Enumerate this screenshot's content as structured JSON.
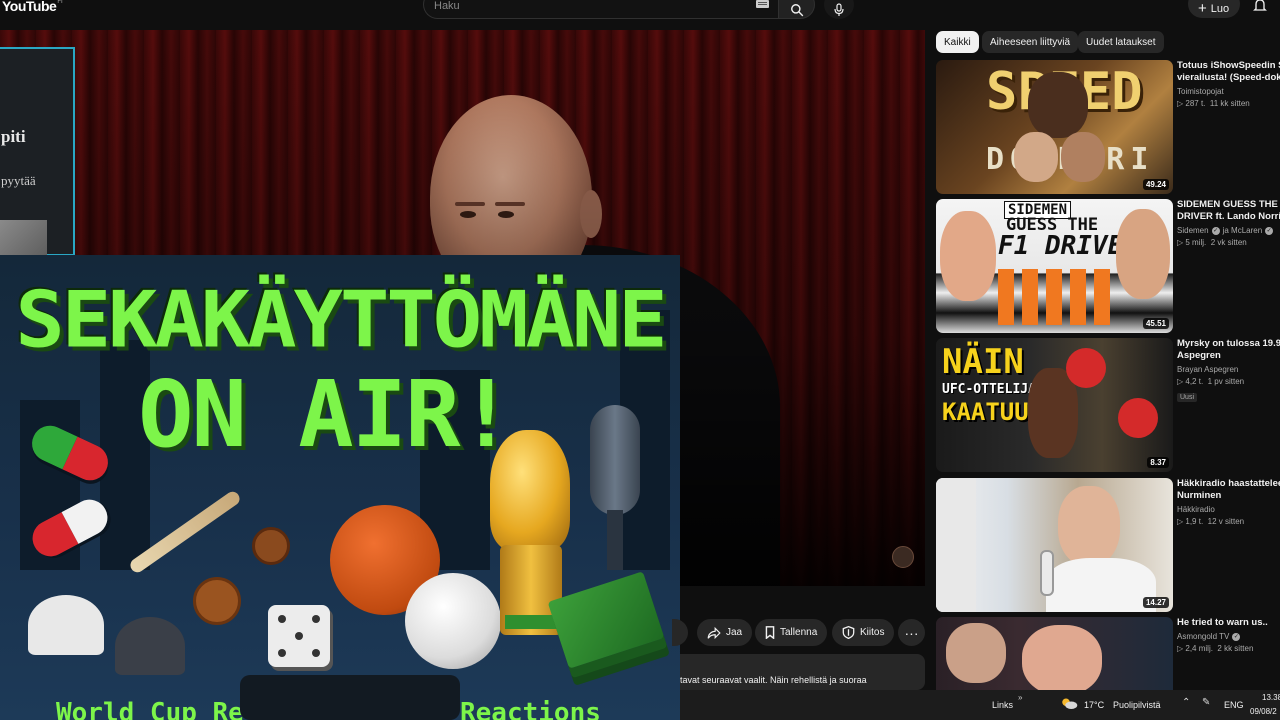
{
  "header": {
    "logo_text": "YouTube",
    "logo_region": "FI",
    "search_placeholder": "Haku",
    "create_label": "Luo"
  },
  "side_panel": {
    "title_fragment": "piti",
    "subtitle_fragment": "pyytää"
  },
  "poster": {
    "title_line1": "SEKAKÄYTTÖMÄNE",
    "title_line2": "ON AIR!",
    "bottom_left": "World Cup Re",
    "bottom_right": "Reactions"
  },
  "actions": {
    "share": "Jaa",
    "save": "Tallenna",
    "thanks": "Kiitos"
  },
  "description": {
    "text": "tavat seuraavat vaalit. Näin rehellistä ja suoraa"
  },
  "chips": [
    {
      "label": "Kaikki",
      "active": true
    },
    {
      "label": "Aiheeseen liittyviä",
      "active": false
    },
    {
      "label": "Uudet lataukset",
      "active": false
    }
  ],
  "recommendations": [
    {
      "title": "Totuus iShowSpeedin Su",
      "title2": "vierailusta! (Speed-doku",
      "channel": "Toimistopojat",
      "verified": false,
      "views": "287 t.",
      "age": "11 kk sitten",
      "duration": "49.24",
      "thumb_text1": "SPEED",
      "thumb_text2": "DOKKARI"
    },
    {
      "title": "SIDEMEN GUESS THE F1",
      "title2": "DRIVER ft. Lando Norris",
      "channel": "Sidemen",
      "channel_extra": "ja McLaren",
      "verified": true,
      "views": "5 milj.",
      "age": "2 vk sitten",
      "duration": "45.51",
      "thumb_text1": "GUESS THE",
      "thumb_text2": "F1 DRIVER",
      "thumb_text3": "SIDEMEN"
    },
    {
      "title": "Myrsky on tulossa 19.9 |",
      "title2": "Aspegren",
      "channel": "Brayan Aspegren",
      "verified": false,
      "views": "4,2 t.",
      "age": "1 pv sitten",
      "badge": "Uusi",
      "duration": "8.37",
      "thumb_text1": "NÄIN",
      "thumb_text2": "UFC-OTTELIJA",
      "thumb_text3": "KAATUU"
    },
    {
      "title": "Häkkiradio haastattelee",
      "title2": "Nurminen",
      "channel": "Häkkiradio",
      "verified": false,
      "views": "1,9 t.",
      "age": "12 v sitten",
      "duration": "14.27"
    },
    {
      "title": "He tried to warn us..",
      "title2": "",
      "channel": "Asmongold TV",
      "verified": true,
      "views": "2,4 milj.",
      "age": "2 kk sitten"
    }
  ],
  "taskbar": {
    "links": "Links",
    "temperature": "17°C",
    "condition": "Puolipilvistä",
    "language": "ENG",
    "time": "13.38",
    "date": "09/08/2"
  },
  "colors": {
    "accent_green": "#7df54a",
    "player_border": "#2aa7c4",
    "bg": "#0f0f0f"
  }
}
